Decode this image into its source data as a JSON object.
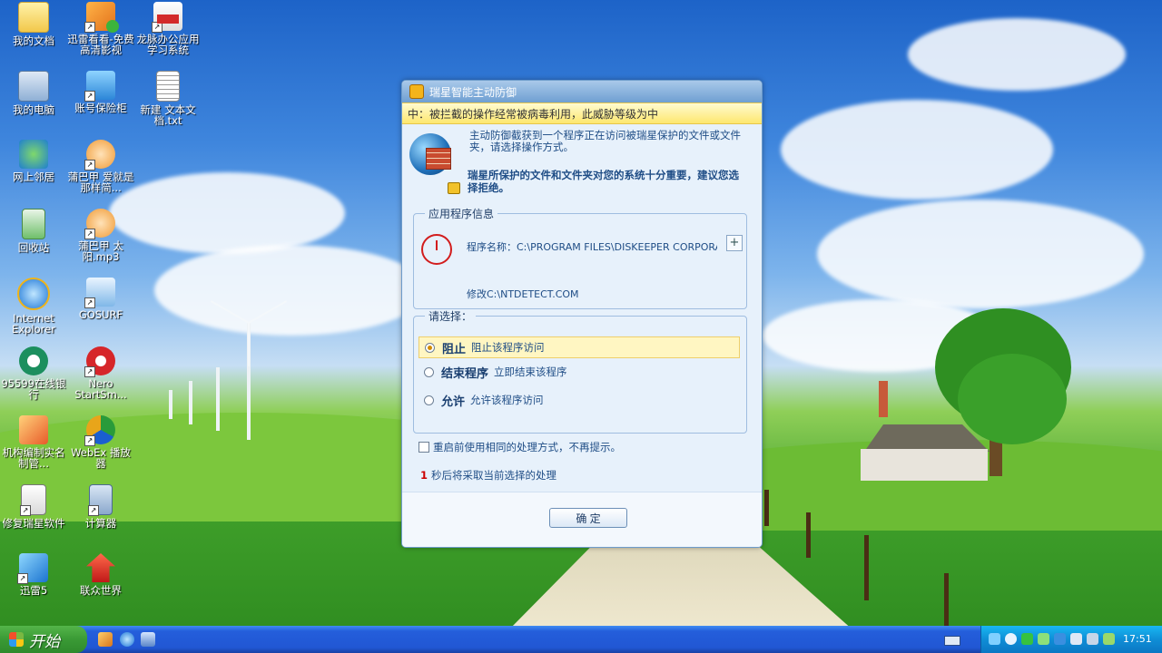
{
  "desktop": {
    "icons": [
      {
        "label": "我的文档",
        "icon": "folder-icon"
      },
      {
        "label": "迅雷看看-免费高清影视",
        "icon": "xunlei-kankan-icon"
      },
      {
        "label": "龙脉办公应用学习系统",
        "icon": "office-learning-icon"
      },
      {
        "label": "我的电脑",
        "icon": "computer-icon"
      },
      {
        "label": "账号保险柜",
        "icon": "account-safe-icon"
      },
      {
        "label": "新建 文本文档.txt",
        "icon": "text-file-icon"
      },
      {
        "label": "网上邻居",
        "icon": "network-icon"
      },
      {
        "label": "蒲巴甲 爱就是那样简...",
        "icon": "music-file-icon"
      },
      {
        "label": "回收站",
        "icon": "recycle-bin-icon"
      },
      {
        "label": "蒲巴甲 太阳.mp3",
        "icon": "mp3-file-icon"
      },
      {
        "label": "Internet Explorer",
        "icon": "ie-icon"
      },
      {
        "label": "GOSURF",
        "icon": "gosurf-icon"
      },
      {
        "label": "95599在线银行",
        "icon": "bank-icon"
      },
      {
        "label": "Nero StartSm...",
        "icon": "nero-icon"
      },
      {
        "label": "机构编制实名制管...",
        "icon": "org-system-icon"
      },
      {
        "label": "WebEx 播放器",
        "icon": "webex-player-icon"
      },
      {
        "label": "修复瑞星软件",
        "icon": "repair-rising-icon"
      },
      {
        "label": "计算器",
        "icon": "calculator-icon"
      },
      {
        "label": "迅雷5",
        "icon": "xunlei-icon"
      },
      {
        "label": "联众世界",
        "icon": "lianzhong-icon"
      }
    ]
  },
  "dialog": {
    "title": "瑞星智能主动防御",
    "warning": "中：被拦截的操作经常被病毒利用，此威胁等级为中",
    "intro": "主动防御截获到一个程序正在访问被瑞星保护的文件或文件夹，请选择操作方式。",
    "important": "瑞星所保护的文件和文件夹对您的系统十分重要，建议您选择拒绝。",
    "app_info_legend": "应用程序信息",
    "program_label": "程序名称：C:\\PROGRAM FILES\\DISKEEPER CORPORAT:",
    "expand": "+",
    "modify": "修改C:\\NTDETECT.COM",
    "choose_legend": "请选择：",
    "options": [
      {
        "title": "阻止",
        "desc": "阻止该程序访问",
        "selected": true
      },
      {
        "title": "结束程序",
        "desc": "立即结束该程序",
        "selected": false
      },
      {
        "title": "允许",
        "desc": "允许该程序访问",
        "selected": false
      }
    ],
    "remember": "重启前使用相同的处理方式，不再提示。",
    "countdown_num": "1",
    "countdown_text": "秒后将采取当前选择的处理",
    "ok": "确 定"
  },
  "taskbar": {
    "start": "开始",
    "clock": "17:51"
  },
  "colors": {
    "taskbar": "#245edb",
    "start": "#3a9a35",
    "warning": "#fde76f",
    "dialog": "#e7f1fb"
  }
}
